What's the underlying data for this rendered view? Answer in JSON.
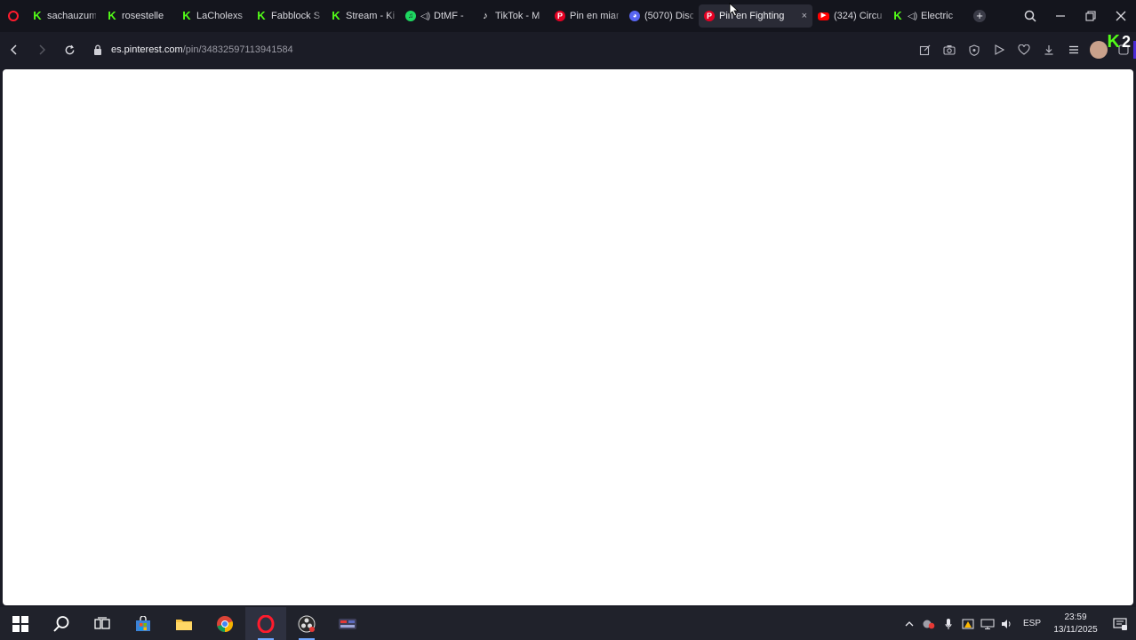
{
  "tabs": [
    {
      "icon": "kick-icon",
      "glyph": "K",
      "label": "sachauzum"
    },
    {
      "icon": "kick-icon",
      "glyph": "K",
      "label": "rosestelle"
    },
    {
      "icon": "kick-icon",
      "glyph": "K",
      "label": "LaCholexs"
    },
    {
      "icon": "kick-icon",
      "glyph": "K",
      "label": "Fabblock S"
    },
    {
      "icon": "kick-icon",
      "glyph": "K",
      "label": "Stream - Ki"
    },
    {
      "icon": "spotify-icon",
      "glyph": "♫",
      "label": "DtMF -"
    },
    {
      "icon": "tiktok-icon",
      "glyph": "♪",
      "label": "TikTok - M"
    },
    {
      "icon": "pinterest-icon",
      "glyph": "P",
      "label": "Pin en mian"
    },
    {
      "icon": "discord-icon",
      "glyph": "◕",
      "label": "(5070) Disc"
    },
    {
      "icon": "pinterest-icon",
      "glyph": "P",
      "label": "Pin en Fighting"
    },
    {
      "icon": "youtube-icon",
      "glyph": "▶",
      "label": "(324) Circu"
    },
    {
      "icon": "kick-icon",
      "glyph": "K",
      "label": "Electric"
    }
  ],
  "active_tab_index": 9,
  "address_bar": {
    "host": "es.pinterest.com",
    "path": "/pin/34832597113941584"
  },
  "kick_overlay": {
    "glyph": "K",
    "count": "2"
  },
  "taskbar": {
    "language": "ESP",
    "time": "23:59",
    "date": "13/11/2025"
  }
}
